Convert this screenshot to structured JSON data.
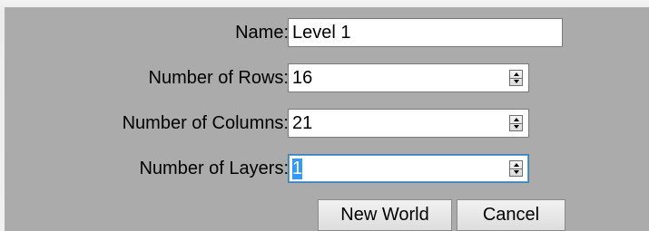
{
  "form": {
    "name": {
      "label": "Name:",
      "value": "Level 1"
    },
    "rows": {
      "label": "Number of Rows:",
      "value": "16"
    },
    "columns": {
      "label": "Number of Columns:",
      "value": "21"
    },
    "layers": {
      "label": "Number of Layers:",
      "value": "1",
      "selected": true,
      "focused": true
    }
  },
  "buttons": {
    "new_world": "New World",
    "cancel": "Cancel"
  },
  "colors": {
    "dialog_bg": "#ababab",
    "selection": "#3399ff",
    "focus_border": "#3c7fb1"
  },
  "icons": {
    "spinner_up": "triangle-up",
    "spinner_down": "triangle-down"
  }
}
